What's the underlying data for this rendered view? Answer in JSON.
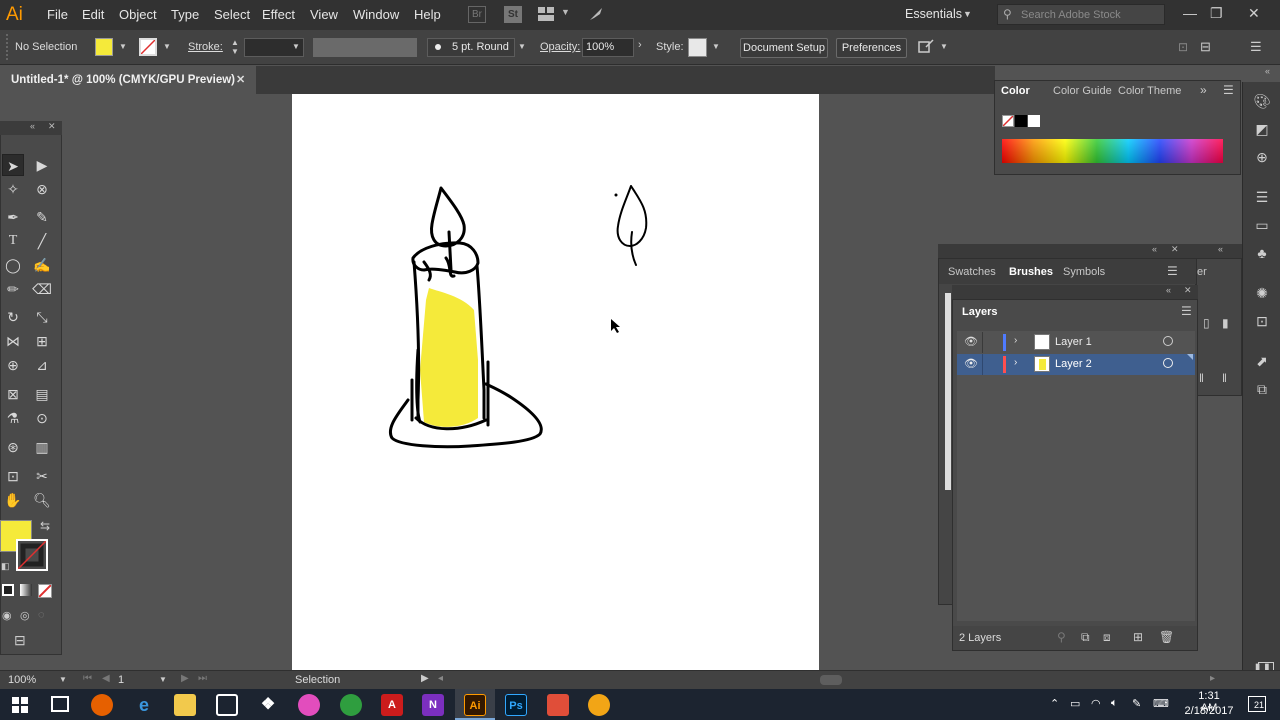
{
  "app": {
    "logo": "Ai",
    "menus": [
      "File",
      "Edit",
      "Object",
      "Type",
      "Select",
      "Effect",
      "View",
      "Window",
      "Help"
    ],
    "br_label": "Br",
    "st_label": "St",
    "workspace": "Essentials",
    "search_placeholder": "Search Adobe Stock"
  },
  "control": {
    "selection": "No Selection",
    "fill_color": "#f5ea3a",
    "stroke_label": "Stroke:",
    "brush": "5 pt. Round",
    "opacity_label": "Opacity:",
    "opacity": "100%",
    "style_label": "Style:",
    "document_setup": "Document Setup",
    "preferences": "Preferences"
  },
  "document": {
    "tab_title": "Untitled-1* @ 100% (CMYK/GPU Preview)",
    "close_glyph": "✕"
  },
  "color_panel": {
    "tabs": [
      "Color",
      "Color Guide",
      "Color Theme"
    ]
  },
  "brushes_panel": {
    "tabs": [
      "Swatches",
      "Brushes",
      "Symbols"
    ],
    "overflow_tab": "er"
  },
  "layers_panel": {
    "title": "Layers",
    "layers": [
      {
        "name": "Layer 1",
        "color": "#4f7bff",
        "selected": false
      },
      {
        "name": "Layer 2",
        "color": "#ff4f4f",
        "selected": true
      }
    ],
    "footer": "2 Layers"
  },
  "status": {
    "zoom": "100%",
    "artboard": "1",
    "tool": "Selection"
  },
  "taskbar": {
    "time": "1:31 AM",
    "date": "2/18/2017",
    "notification_count": "21",
    "icons": [
      "start-icon",
      "task-view-icon",
      "firefox-icon",
      "edge-icon",
      "file-explorer-icon",
      "store-icon",
      "dropbox-icon",
      "itunes-icon",
      "xbox-icon",
      "acrobat-icon",
      "onenote-icon",
      "illustrator-icon",
      "photoshop-icon",
      "foxit-icon",
      "norton-icon"
    ]
  },
  "colors": {
    "fill_yellow": "#f5ea3a",
    "accent_orange": "#ff9a00",
    "selection_blue": "#3f5f8f"
  }
}
